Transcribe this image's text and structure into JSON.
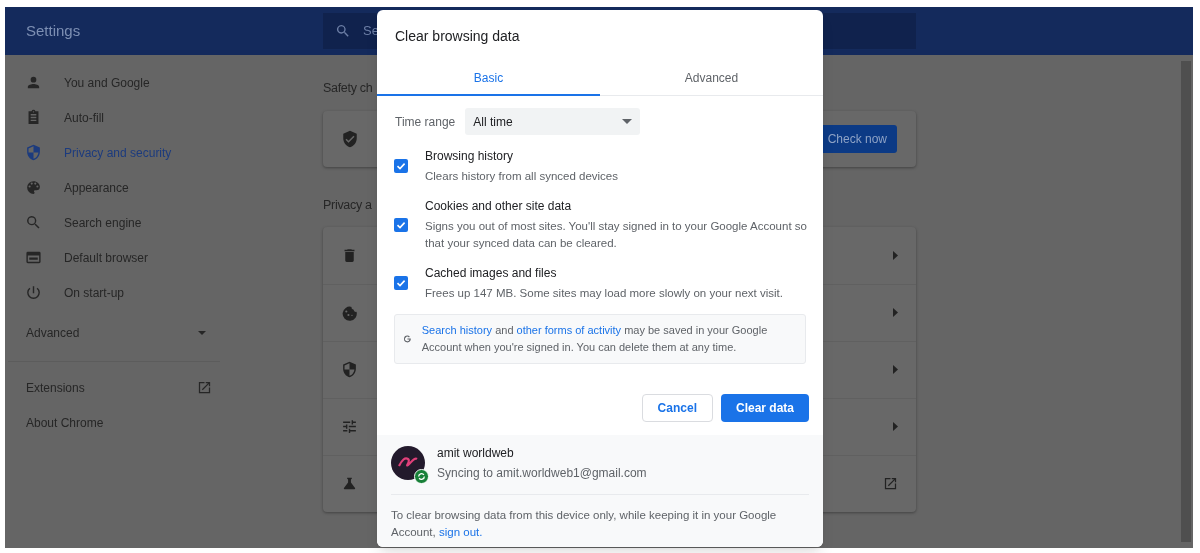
{
  "header": {
    "title": "Settings",
    "search_placeholder": "Se"
  },
  "sidebar": {
    "items": [
      {
        "label": "You and Google",
        "selected": false
      },
      {
        "label": "Auto-fill",
        "selected": false
      },
      {
        "label": "Privacy and security",
        "selected": true
      },
      {
        "label": "Appearance",
        "selected": false
      },
      {
        "label": "Search engine",
        "selected": false
      },
      {
        "label": "Default browser",
        "selected": false
      },
      {
        "label": "On start-up",
        "selected": false
      }
    ],
    "advanced": {
      "label": "Advanced",
      "expanded": false
    },
    "links": [
      {
        "label": "Extensions",
        "external": true
      },
      {
        "label": "About Chrome",
        "external": false
      }
    ]
  },
  "content": {
    "safety_heading": "Safety ch",
    "check_button": "Check now",
    "privacy_heading": "Privacy a",
    "rows": [
      {
        "kind": "subpage"
      },
      {
        "kind": "subpage"
      },
      {
        "kind": "subpage"
      },
      {
        "kind": "subpage"
      },
      {
        "kind": "external"
      }
    ]
  },
  "dialog": {
    "title": "Clear browsing data",
    "tabs": [
      {
        "label": "Basic",
        "selected": true
      },
      {
        "label": "Advanced",
        "selected": false
      }
    ],
    "time_range": {
      "label": "Time range",
      "value": "All time"
    },
    "options": [
      {
        "title": "Browsing history",
        "description": "Clears history from all synced devices",
        "checked": true
      },
      {
        "title": "Cookies and other site data",
        "description": "Signs you out of most sites. You'll stay signed in to your Google Account so that your synced data can be cleared.",
        "checked": true
      },
      {
        "title": "Cached images and files",
        "description": "Frees up 147 MB. Some sites may load more slowly on your next visit.",
        "checked": true
      }
    ],
    "info": {
      "link_1": "Search history",
      "text_1": "and",
      "link_2": "other forms of activity",
      "text_2": "may be saved in your Google Account when you're signed in. You can delete them at any time."
    },
    "buttons": [
      {
        "label": "Cancel",
        "kind": "secondary"
      },
      {
        "label": "Clear data",
        "kind": "primary"
      }
    ],
    "account": {
      "name": "amit worldweb",
      "status": "Syncing to amit.worldweb1@gmail.com",
      "syncing": true
    },
    "note": {
      "text": "To clear browsing data from this device only, while keeping it in your Google Account,",
      "link": "sign out."
    }
  }
}
